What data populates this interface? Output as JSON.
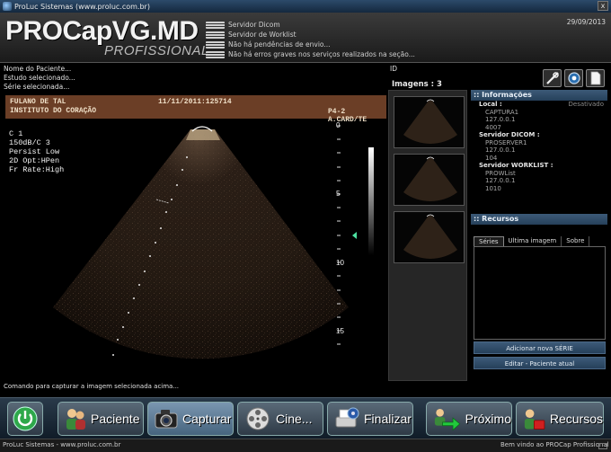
{
  "window": {
    "title": "ProLuc Sistemas (www.proluc.com.br)",
    "close_glyph": "x"
  },
  "header": {
    "logo": "PROCapVG.MD",
    "logo_sub": "PROFISSIONAL",
    "date": "29/09/2013",
    "status": [
      "Servidor Dicom",
      "Servidor de Worklist",
      "Não há pendências de envio...",
      "Não há erros graves nos serviços realizados na seção..."
    ]
  },
  "patient": {
    "name": "Nome do Paciente...",
    "study": "Estudo selecionado...",
    "series": "Série selecionada..."
  },
  "id_label": "ID",
  "tools": [
    {
      "name": "tools-icon"
    },
    {
      "name": "settings-icon"
    },
    {
      "name": "document-icon"
    }
  ],
  "viewer": {
    "patient_name": "FULANO DE TAL",
    "institution": "INSTITUTO DO CORAÇÃO",
    "datetime": "11/11/2011:125714",
    "probe": "P4-2 A.CARD/TE",
    "params": [
      "C 1",
      "150dB/C 3",
      "Persist Low",
      "2D Opt:HPen",
      "Fr Rate:High"
    ],
    "depth_marks": [
      "0",
      "5",
      "10",
      "15"
    ]
  },
  "status_message": "Comando para capturar a imagem selecionada acima...",
  "images": {
    "title": "Imagens : 3"
  },
  "informacoes": {
    "title": ":: Informações",
    "local_label": "Local :",
    "local_state": "Desativado",
    "local_values": [
      "CAPTURA1",
      "127.0.0.1",
      "4007"
    ],
    "dicom_label": "Servidor DICOM :",
    "dicom_values": [
      "PROSERVER1",
      "127.0.0.1",
      "104"
    ],
    "worklist_label": "Servidor WORKLIST :",
    "worklist_values": [
      "PROWList",
      "127.0.0.1",
      "1010"
    ]
  },
  "recursos": {
    "title": ":: Recursos",
    "tabs": [
      "Séries",
      "Ultima imagem",
      "Sobre"
    ],
    "add_series": "Adicionar nova SÉRIE",
    "edit_patient": "Editar - Paciente atual"
  },
  "toolbar": {
    "paciente": "Paciente",
    "capturar": "Capturar",
    "cine": "Cine...",
    "finalizar": "Finalizar",
    "proximo": "Próximo",
    "recursos": "Recursos"
  },
  "footer": {
    "left": "ProLuc Sistemas - www.proluc.com.br",
    "right": "Bem vindo ao PROCap Profissional"
  },
  "colors": {
    "accent": "#6b3e26",
    "panel_title": "#3c5a78"
  }
}
